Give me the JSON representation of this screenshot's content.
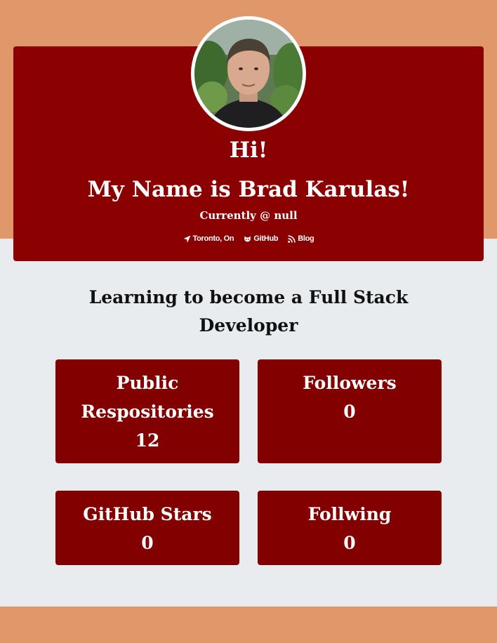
{
  "profile": {
    "greeting": "Hi!",
    "name_line": "My Name is Brad Karulas!",
    "company_line": "Currently @ null",
    "links": [
      {
        "icon": "location-arrow-icon",
        "label": "Toronto, On"
      },
      {
        "icon": "github-icon",
        "label": "GitHub"
      },
      {
        "icon": "rss-icon",
        "label": "Blog"
      }
    ]
  },
  "bio": "Learning to become a Full Stack Developer",
  "stats": [
    {
      "label": "Public Respositories",
      "value": "12"
    },
    {
      "label": "Followers",
      "value": "0"
    },
    {
      "label": "GitHub Stars",
      "value": "0"
    },
    {
      "label": "Follwing",
      "value": "0"
    }
  ],
  "colors": {
    "band": "#e0976a",
    "card": "#8b0000",
    "page_background": "#e8ecee",
    "text_light": "#ffffff"
  }
}
